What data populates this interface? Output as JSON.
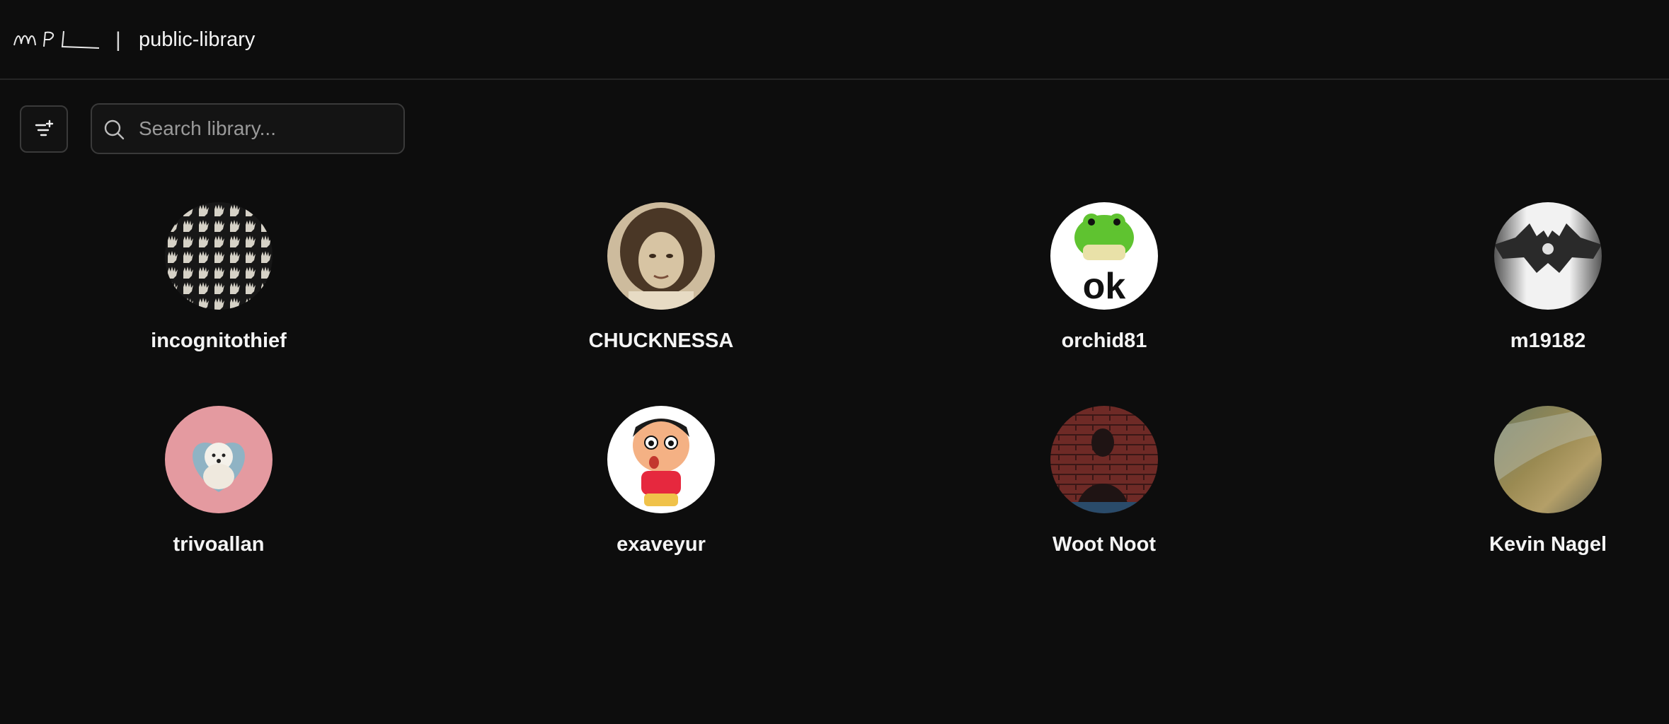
{
  "header": {
    "logo_text": "WPL",
    "separator": "|",
    "title": "public-library"
  },
  "toolbar": {
    "filter_icon": "filter-add-icon",
    "search": {
      "icon": "search-icon",
      "placeholder": "Search library...",
      "value": ""
    }
  },
  "profiles": [
    {
      "name": "incognitothief",
      "avatar": "hands-pattern-avatar"
    },
    {
      "name": "CHUCKNESSA",
      "avatar": "vintage-portrait-avatar"
    },
    {
      "name": "orchid81",
      "avatar": "frog-ok-avatar"
    },
    {
      "name": "m19182",
      "avatar": "bat-logo-avatar"
    },
    {
      "name": "trivoallan",
      "avatar": "poodle-heart-avatar"
    },
    {
      "name": "exaveyur",
      "avatar": "cartoon-boy-avatar"
    },
    {
      "name": "Woot Noot",
      "avatar": "brick-wall-figure-avatar"
    },
    {
      "name": "Kevin Nagel",
      "avatar": "blurred-landscape-avatar"
    }
  ],
  "colors": {
    "background": "#0d0d0d",
    "border": "#3a3a3a",
    "text": "#f4f4f4",
    "placeholder": "#9a9a9a"
  }
}
